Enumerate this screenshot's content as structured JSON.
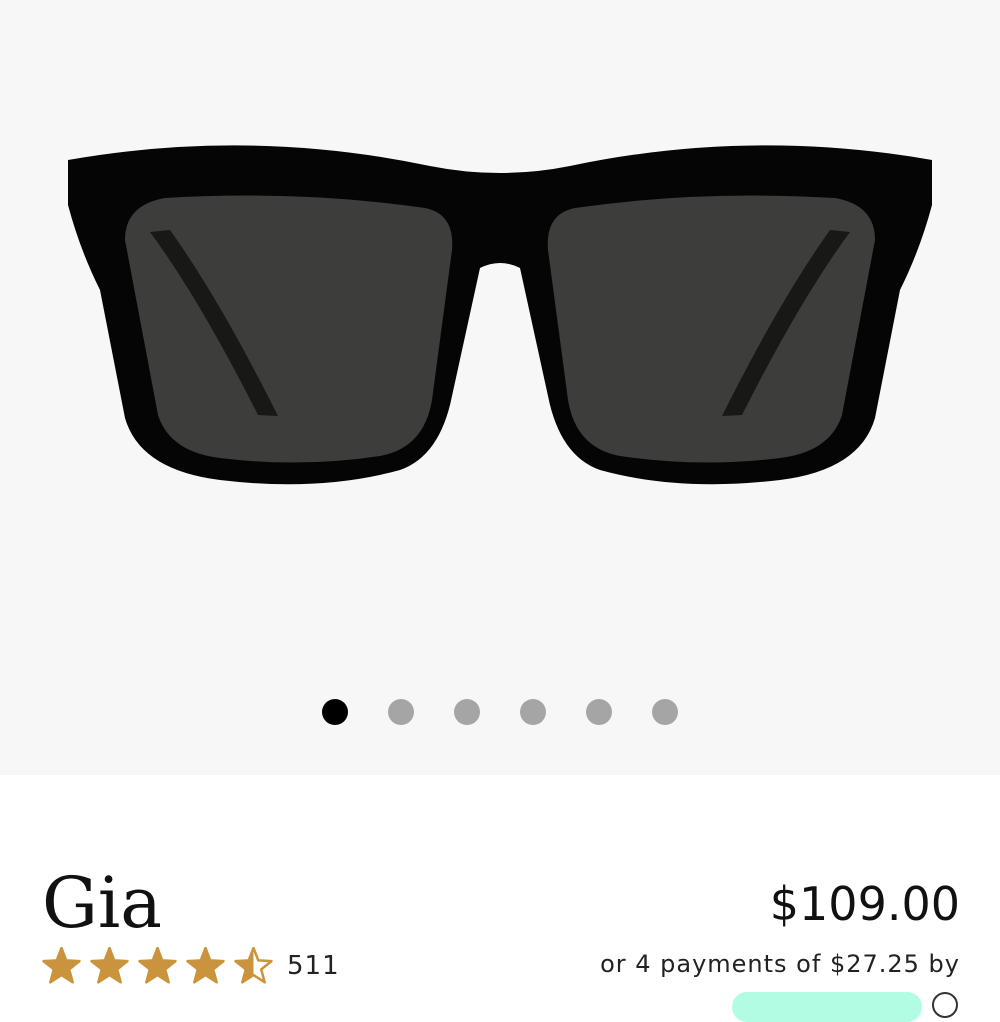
{
  "product": {
    "name": "Gia",
    "rating_value": 4.5,
    "rating_max": 5,
    "review_count": "511",
    "price": "$109.00",
    "installments_text": "or 4 payments of $27.25 by"
  },
  "gallery": {
    "image_icon": "sunglasses-product-photo",
    "total_images": 6,
    "active_index": 0
  },
  "colors": {
    "gallery_background": "#f7f7f7",
    "star": "#c9943d",
    "dot_active": "#000000",
    "dot_inactive": "#a5a5a5",
    "afterpay_badge": "#b2fce4"
  }
}
